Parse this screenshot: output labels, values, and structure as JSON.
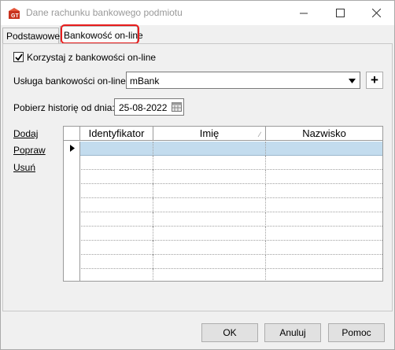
{
  "window": {
    "title": "Dane rachunku bankowego podmiotu"
  },
  "tabs": [
    {
      "label": "Podstawowe"
    },
    {
      "label": "Bankowość on-line"
    }
  ],
  "online": {
    "use_online_label": "Korzystaj z bankowości on-line",
    "use_online_checked": true,
    "service_label": "Usługa bankowości on-line:",
    "service_value": "mBank",
    "history_label": "Pobierz historię od dnia:",
    "history_date": "25-08-2022"
  },
  "actions": {
    "add": "Dodaj",
    "edit": "Popraw",
    "delete": "Usuń"
  },
  "grid": {
    "columns": [
      "Identyfikator",
      "Imię",
      "Nazwisko"
    ],
    "rows": []
  },
  "buttons": {
    "ok": "OK",
    "cancel": "Anuluj",
    "help": "Pomoc"
  },
  "colors": {
    "accent_highlight": "#e81c1c",
    "selected_row": "#c3dcee"
  },
  "icons": [
    "app-icon",
    "minimize-icon",
    "maximize-icon",
    "close-icon",
    "check-icon",
    "dropdown-arrow-icon",
    "plus-icon",
    "calendar-icon",
    "row-pointer-icon",
    "sort-indicator-icon"
  ]
}
